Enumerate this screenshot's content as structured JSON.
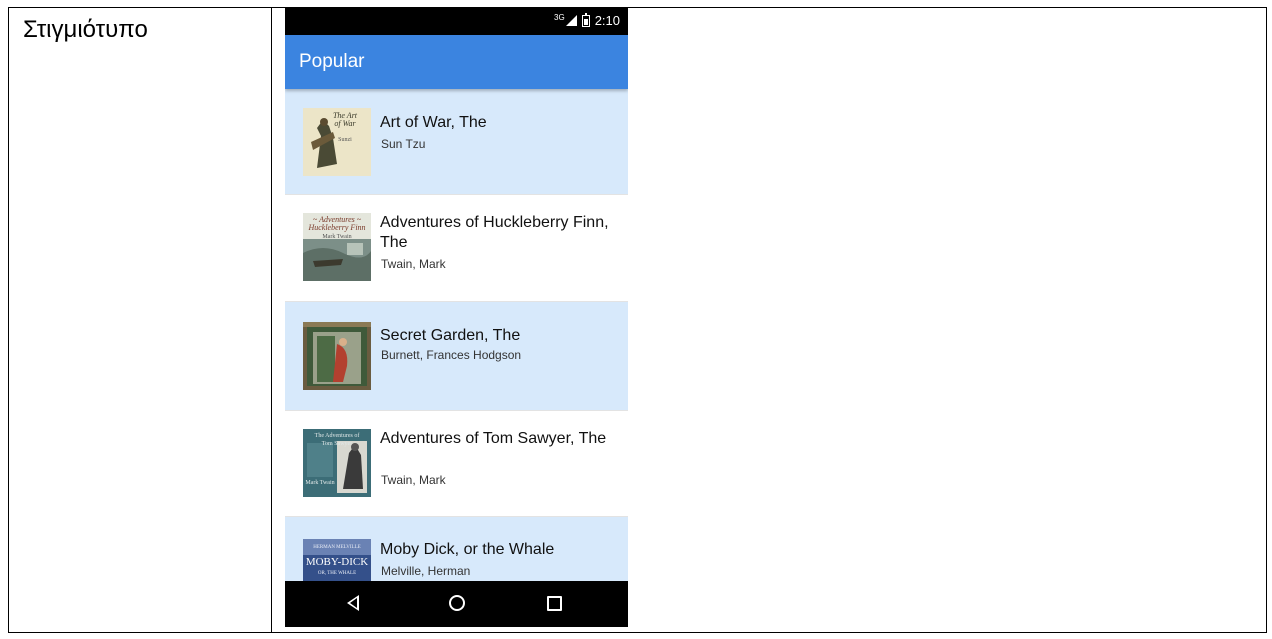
{
  "document": {
    "label": "Στιγμιότυπο"
  },
  "status_bar": {
    "network_type": "3G",
    "time": "2:10"
  },
  "app_bar": {
    "title": "Popular"
  },
  "books": [
    {
      "title": "Art of War, The",
      "author": "Sun Tzu",
      "cover_text": [
        "The Art",
        "of War",
        "Sunzi"
      ]
    },
    {
      "title": "Adventures of Huckleberry Finn, The",
      "author": "Twain, Mark",
      "cover_text": [
        "~ Adventures ~",
        "Huckleberry Finn",
        "Mark Twain"
      ]
    },
    {
      "title": "Secret Garden, The",
      "author": "Burnett, Frances Hodgson",
      "cover_text": []
    },
    {
      "title": "Adventures of Tom Sawyer, The",
      "author": "Twain, Mark",
      "cover_text": [
        "The Adventures of",
        "Tom Sawyer",
        "Mark Twain"
      ]
    },
    {
      "title": "Moby Dick, or the Whale",
      "author": "Melville, Herman",
      "cover_text": [
        "HERMAN MELVILLE",
        "MOBY-DICK",
        "OR, THE WHALE"
      ]
    }
  ],
  "colors": {
    "app_bar": "#3b84e0",
    "row_highlight": "#d7e9fb"
  },
  "icons": {
    "nav_back": "triangle-back-icon",
    "nav_home": "circle-home-icon",
    "nav_recent": "square-recent-icon"
  }
}
